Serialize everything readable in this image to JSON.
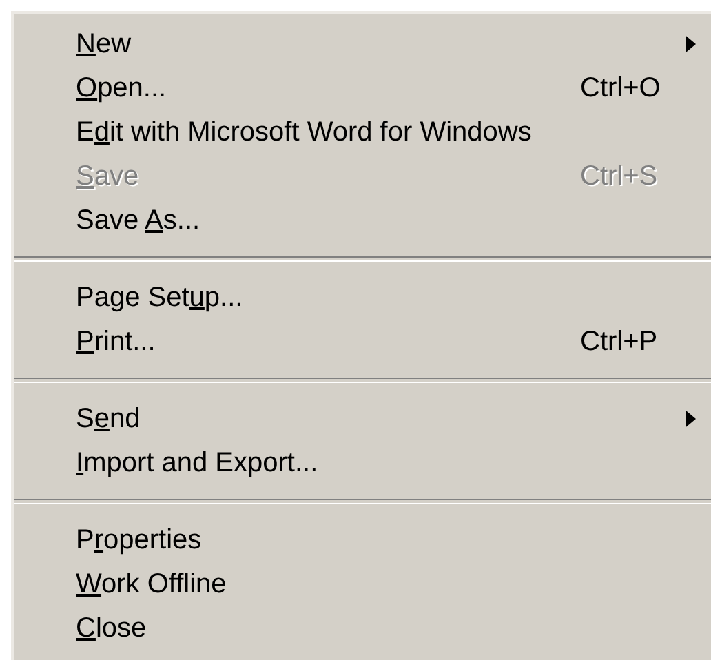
{
  "menu": {
    "items": [
      {
        "kind": "item",
        "label": {
          "key": "N",
          "post": "ew"
        },
        "submenu": true,
        "disabled": false
      },
      {
        "kind": "item",
        "label": {
          "key": "O",
          "post": "pen..."
        },
        "shortcut": "Ctrl+O",
        "submenu": false,
        "disabled": false
      },
      {
        "kind": "item",
        "label": {
          "pre": "E",
          "key": "d",
          "post": "it with Microsoft Word for Windows"
        },
        "submenu": false,
        "disabled": false
      },
      {
        "kind": "item",
        "label": {
          "key": "S",
          "post": "ave"
        },
        "shortcut": "Ctrl+S",
        "submenu": false,
        "disabled": true
      },
      {
        "kind": "item",
        "label": {
          "pre": "Save ",
          "key": "A",
          "post": "s..."
        },
        "submenu": false,
        "disabled": false
      },
      {
        "kind": "separator"
      },
      {
        "kind": "item",
        "label": {
          "pre": "Page Set",
          "key": "u",
          "post": "p..."
        },
        "submenu": false,
        "disabled": false
      },
      {
        "kind": "item",
        "label": {
          "key": "P",
          "post": "rint..."
        },
        "shortcut": "Ctrl+P",
        "submenu": false,
        "disabled": false
      },
      {
        "kind": "separator"
      },
      {
        "kind": "item",
        "label": {
          "pre": "S",
          "key": "e",
          "post": "nd"
        },
        "submenu": true,
        "disabled": false
      },
      {
        "kind": "item",
        "label": {
          "key": "I",
          "post": "mport and Export..."
        },
        "submenu": false,
        "disabled": false
      },
      {
        "kind": "separator"
      },
      {
        "kind": "item",
        "label": {
          "pre": "P",
          "key": "r",
          "post": "operties"
        },
        "submenu": false,
        "disabled": false
      },
      {
        "kind": "item",
        "label": {
          "key": "W",
          "post": "ork Offline"
        },
        "submenu": false,
        "disabled": false
      },
      {
        "kind": "item",
        "label": {
          "key": "C",
          "post": "lose"
        },
        "submenu": false,
        "disabled": false
      }
    ]
  }
}
